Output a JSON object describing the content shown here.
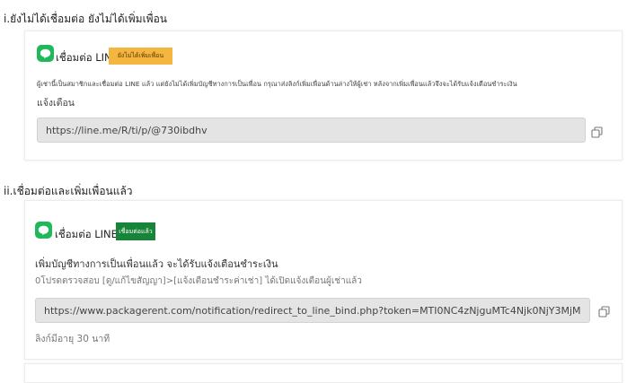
{
  "section1": {
    "heading": "i.ยังไม่ได้เชื่อมต่อ ยังไม่ได้เพิ่มเพื่อน",
    "card_title": "เชื่อมต่อ LINE",
    "badge": "ยังไม่ได้เพิ่มเพื่อน",
    "desc_line1": "ผู้เช่านี้เป็นสมาชิกและเชื่อมต่อ LINE แล้ว แต่ยังไม่ได้เพิ่มบัญชีทางการเป็นเพื่อน กรุณาส่งลิงก์เพิ่มเพื่อนด้านล่างให้ผู้เช่า หลังจากเพิ่มเพื่อนแล้วจึงจะได้รับแจ้งเตือนชำระเงิน",
    "desc_line2": "แจ้งเตือน",
    "url": "https://line.me/R/ti/p/@730ibdhv"
  },
  "section2": {
    "heading": "ii.เชื่อมต่อและเพิ่มเพื่อนแล้ว",
    "card_title": "เชื่อมต่อ LINE",
    "badge": "เชื่อมต่อแล้ว",
    "desc_line1": "เพิ่มบัญชีทางการเป็นเพื่อนแล้ว จะได้รับแจ้งเตือนชำระเงิน",
    "desc_line2": "0โปรดตรวจสอบ [ดู/แก้ไขสัญญา]>[แจ้งเตือนชำระค่าเช่า] ได้เปิดแจ้งเตือนผู้เช่าแล้ว",
    "url": "https://www.packagerent.com/notification/redirect_to_line_bind.php?token=MTI0NC4zNjguMTc4Njk0NjY3MjM",
    "expiry": "ลิงก์มีอายุ 30 นาที"
  },
  "icons": {
    "line_logo": "line-logo-icon",
    "copy": "copy-icon"
  },
  "colors": {
    "line_green": "#1fb85a",
    "badge_yellow": "#f4b63f",
    "badge_green": "#18843a",
    "url_box_bg": "#e4e4e4"
  }
}
